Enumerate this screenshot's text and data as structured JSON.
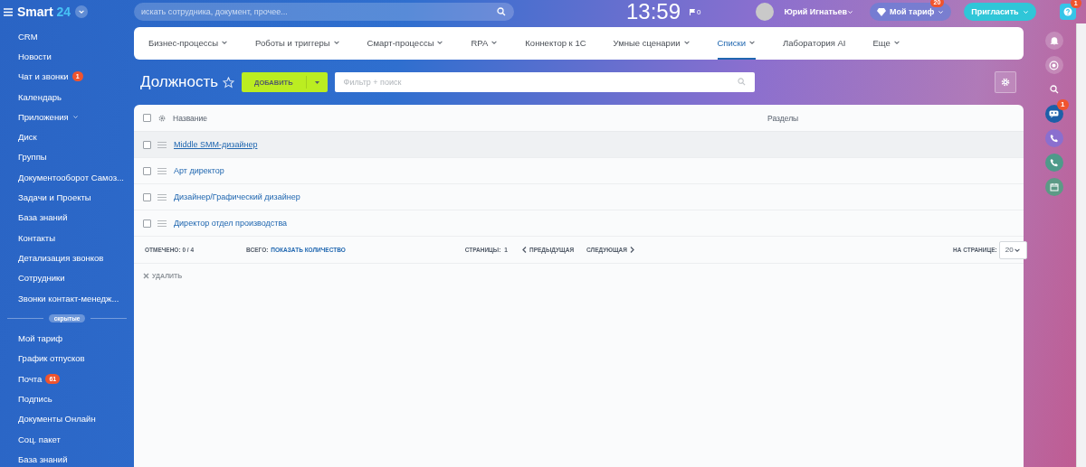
{
  "header": {
    "logo": "Smart",
    "logo_number": "24",
    "search": {
      "placeholder": "искать сотрудника, документ, прочее..."
    },
    "clock": "13:59",
    "flag_count": "0",
    "user_name": "Юрий Игнатьев",
    "tariff": {
      "label": "Мой тариф",
      "badge": "20"
    },
    "invite": "Пригласить",
    "help_badge": "1"
  },
  "sidebar": {
    "items": [
      {
        "label": "CRM",
        "kind": "link"
      },
      {
        "label": "Новости",
        "kind": "link"
      },
      {
        "label": "Чат и звонки",
        "kind": "link",
        "badge": "1"
      },
      {
        "label": "Календарь",
        "kind": "link"
      },
      {
        "label": "Приложения",
        "kind": "group"
      },
      {
        "label": "Диск",
        "kind": "link"
      },
      {
        "label": "Группы",
        "kind": "link"
      },
      {
        "label": "Документооборот Самоз...",
        "kind": "link"
      },
      {
        "label": "Задачи и Проекты",
        "kind": "link"
      },
      {
        "label": "База знаний",
        "kind": "link"
      },
      {
        "label": "Контакты",
        "kind": "link"
      },
      {
        "label": "Детализация звонков",
        "kind": "link"
      },
      {
        "label": "Сотрудники",
        "kind": "link"
      },
      {
        "label": "Звонки контакт-менедж...",
        "kind": "link"
      },
      {
        "label": "скрытые",
        "kind": "divider"
      },
      {
        "label": "Мой тариф",
        "kind": "link"
      },
      {
        "label": "График отпусков",
        "kind": "link"
      },
      {
        "label": "Почта",
        "kind": "link",
        "badge": "61"
      },
      {
        "label": "Подпись",
        "kind": "link"
      },
      {
        "label": "Документы Онлайн",
        "kind": "link"
      },
      {
        "label": "Соц. пакет",
        "kind": "link"
      },
      {
        "label": "База знаний",
        "kind": "link"
      }
    ]
  },
  "nav_tabs": [
    {
      "label": "Бизнес-процессы",
      "dropdown": true,
      "selected": false
    },
    {
      "label": "Роботы и триггеры",
      "dropdown": true,
      "selected": false
    },
    {
      "label": "Смарт-процессы",
      "dropdown": true,
      "selected": false
    },
    {
      "label": "RPA",
      "dropdown": true,
      "selected": false
    },
    {
      "label": "Коннектор к 1С",
      "dropdown": false,
      "selected": false
    },
    {
      "label": "Умные сценарии",
      "dropdown": true,
      "selected": false
    },
    {
      "label": "Списки",
      "dropdown": true,
      "selected": true
    },
    {
      "label": "Лаборатория AI",
      "dropdown": false,
      "selected": false
    },
    {
      "label": "Еще",
      "dropdown": true,
      "selected": false
    }
  ],
  "page": {
    "title": "Должность",
    "starred": false,
    "add_button": "ДОБАВИТЬ",
    "filter": {
      "placeholder": "Фильтр + поиск"
    }
  },
  "table": {
    "all_checked": false,
    "columns": [
      "Название",
      "Разделы"
    ],
    "rows": [
      {
        "name": "Middle SMM-дизайнер",
        "checked": false,
        "highlighted": true
      },
      {
        "name": "Арт директор",
        "checked": false,
        "highlighted": false
      },
      {
        "name": "Дизайнер/Графический дизайнер",
        "checked": false,
        "highlighted": false
      },
      {
        "name": "Директор отдел производства",
        "checked": false,
        "highlighted": false
      }
    ],
    "footer": {
      "marked": "ОТМЕЧЕНО: 0 / 4",
      "total_label": "ВСЕГО:",
      "total_link": "ПОКАЗАТЬ КОЛИЧЕСТВО",
      "pages_label": "СТРАНИЦЫ:",
      "page": "1",
      "prev": "ПРЕДЫДУЩАЯ",
      "next": "СЛЕДУЮЩАЯ",
      "per_page_label": "НА СТРАНИЦЕ:",
      "per_page": "20"
    },
    "delete": {
      "label": "УДАЛИТЬ",
      "disabled": true
    }
  },
  "right_panel": {
    "chat_badge": "1"
  }
}
